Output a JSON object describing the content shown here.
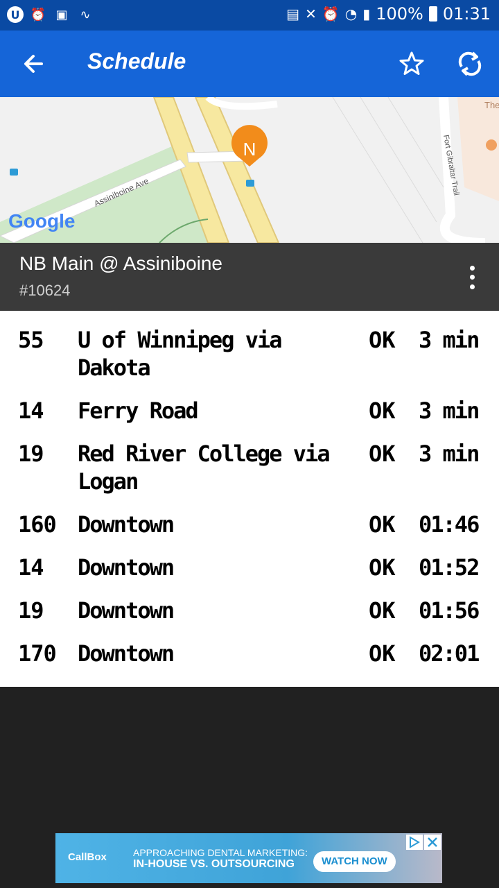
{
  "status_bar": {
    "battery": "100%",
    "time": "01:31",
    "left_icons": [
      "u-icon",
      "alarm-icon",
      "image-icon",
      "pulse-icon"
    ],
    "right_icons": [
      "sim-icon",
      "mute-icon",
      "alarm-icon",
      "wifi-icon",
      "signal-icon",
      "battery-icon"
    ]
  },
  "app_bar": {
    "title": "Schedule",
    "color": "#1565d8"
  },
  "map": {
    "marker_label": "N",
    "street_label": "Assiniboine Ave",
    "street_label_2": "Fort Gibraltar Trail",
    "poi_label": "The",
    "logo": "Google",
    "marker_color": "#f28c1b"
  },
  "stop": {
    "name": "NB Main @ Assiniboine",
    "id": "#10624"
  },
  "schedule": [
    {
      "route": "55",
      "dest_line1": "U of Winnipeg via",
      "dest_line2": "Dakota",
      "status": "OK",
      "time": "3 min"
    },
    {
      "route": "14",
      "dest_line1": "Ferry Road",
      "dest_line2": "",
      "status": "OK",
      "time": "3 min"
    },
    {
      "route": "19",
      "dest_line1": "Red River College via",
      "dest_line2": "Logan",
      "status": "OK",
      "time": "3 min"
    },
    {
      "route": "160",
      "dest_line1": "Downtown",
      "dest_line2": "",
      "status": "OK",
      "time": "01:46"
    },
    {
      "route": "14",
      "dest_line1": "Downtown",
      "dest_line2": "",
      "status": "OK",
      "time": "01:52"
    },
    {
      "route": "19",
      "dest_line1": "Downtown",
      "dest_line2": "",
      "status": "OK",
      "time": "01:56"
    },
    {
      "route": "170",
      "dest_line1": "Downtown",
      "dest_line2": "",
      "status": "OK",
      "time": "02:01"
    }
  ],
  "ad": {
    "brand": "CallBox",
    "line1": "APPROACHING DENTAL MARKETING:",
    "line2": "IN-HOUSE VS. OUTSOURCING",
    "cta": "WATCH NOW"
  }
}
